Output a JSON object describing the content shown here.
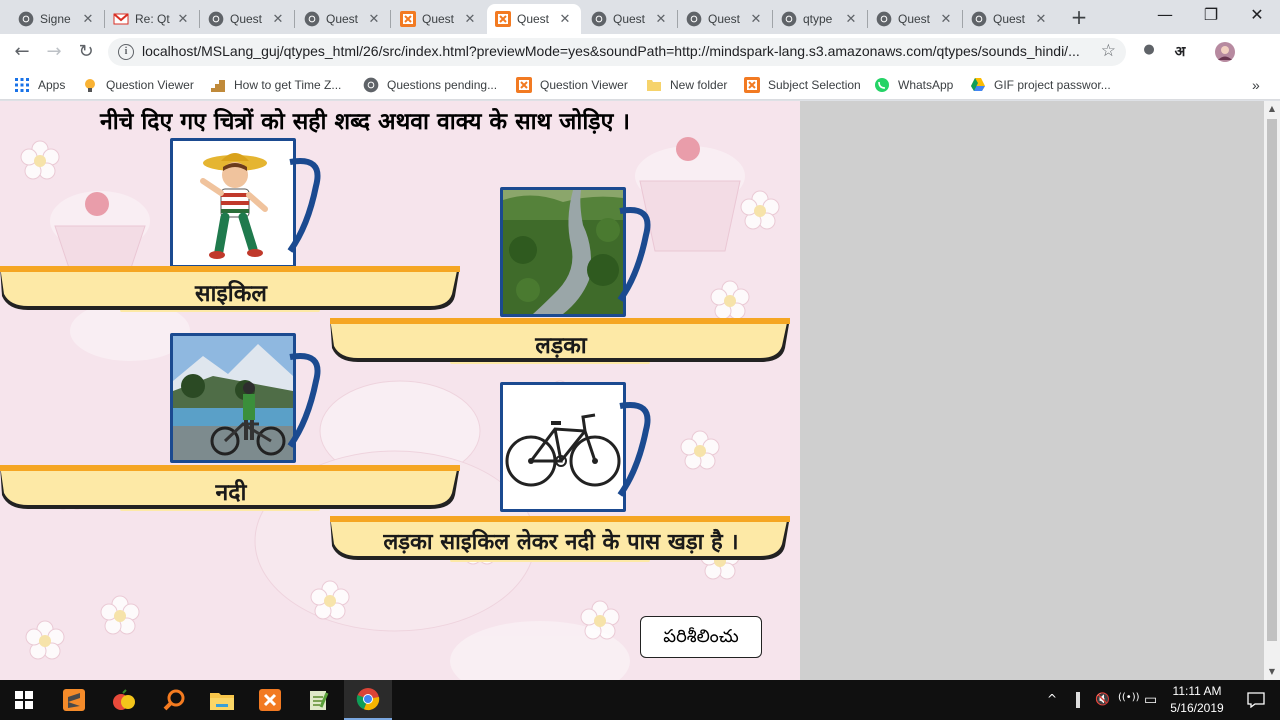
{
  "tabs": [
    {
      "title": "Signe",
      "icon": "chrome-icon",
      "active": false
    },
    {
      "title": "Re: Qt",
      "icon": "gmail-icon",
      "active": false
    },
    {
      "title": "Quest",
      "icon": "chrome-icon",
      "active": false
    },
    {
      "title": "Quest",
      "icon": "chrome-icon",
      "active": false
    },
    {
      "title": "Quest",
      "icon": "xampp-icon",
      "active": false
    },
    {
      "title": "Quest",
      "icon": "xampp-icon",
      "active": true
    },
    {
      "title": "Quest",
      "icon": "chrome-icon",
      "active": false
    },
    {
      "title": "Quest",
      "icon": "chrome-icon",
      "active": false
    },
    {
      "title": "qtype",
      "icon": "chrome-icon",
      "active": false
    },
    {
      "title": "Quest",
      "icon": "chrome-icon",
      "active": false
    },
    {
      "title": "Quest",
      "icon": "chrome-icon",
      "active": false
    }
  ],
  "close_glyph": "✕",
  "new_tab": "+",
  "window": {
    "minimize": "—",
    "restore": "❐",
    "close": "✕"
  },
  "nav": {
    "back": "←",
    "forward": "→",
    "reload": "↻"
  },
  "address": {
    "info_glyph": "i",
    "url": "localhost/MSLang_guj/qtypes_html/26/src/index.html?previewMode=yes&soundPath=http://mindspark-lang.s3.amazonaws.com/qtypes/sounds_hindi/...",
    "star": "☆"
  },
  "extensions": {
    "circle": "●",
    "hindi": "अ"
  },
  "bookmarks": [
    {
      "label": "Apps",
      "icon": "apps-grid-icon"
    },
    {
      "label": "Question Viewer",
      "icon": "bulb-icon"
    },
    {
      "label": "How to get Time Z...",
      "icon": "stairs-icon"
    },
    {
      "label": "Questions pending...",
      "icon": "chrome-icon"
    },
    {
      "label": "Question Viewer",
      "icon": "xampp-icon"
    },
    {
      "label": "New folder",
      "icon": "folder-icon"
    },
    {
      "label": "Subject Selection",
      "icon": "xampp-icon"
    },
    {
      "label": "WhatsApp",
      "icon": "whatsapp-icon"
    },
    {
      "label": "GIF project passwor...",
      "icon": "drive-icon"
    }
  ],
  "bookmarks_more": "»",
  "question": {
    "instruction": "नीचे दिए गए चित्रों को सही शब्द अथवा वाक्य के साथ जोड़िए ।",
    "images": [
      {
        "name": "boy-image",
        "depicts": "boy"
      },
      {
        "name": "river-image",
        "depicts": "river"
      },
      {
        "name": "cyclist-by-river-image",
        "depicts": "boy with bicycle by river"
      },
      {
        "name": "bicycle-image",
        "depicts": "bicycle"
      }
    ],
    "labels": [
      "साइकिल",
      "लड़का",
      "नदी",
      "लड़का साइकिल लेकर नदी के पास खड़ा है ।"
    ],
    "check_button": "పరిశీలించు"
  },
  "colors": {
    "mug_border": "#1b4a90",
    "shelf_top": "#f5a623",
    "shelf_body": "#fde9a6",
    "background_pink": "#f5e6ec"
  },
  "taskbar": {
    "clock_time": "11:11 AM",
    "clock_date": "5/16/2019",
    "tray": {
      "chevron": "^",
      "volume": "🔇",
      "wifi": "((•))",
      "battery": "▭"
    }
  }
}
